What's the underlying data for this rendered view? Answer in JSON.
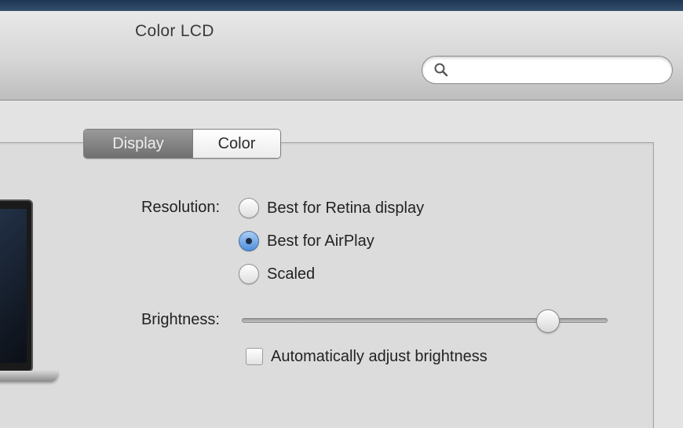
{
  "window": {
    "title": "Color LCD"
  },
  "search": {
    "placeholder": "",
    "value": "",
    "icon": "magnifier-icon"
  },
  "tabs": [
    {
      "label": "Display",
      "selected": true
    },
    {
      "label": "Color",
      "selected": false
    }
  ],
  "resolution": {
    "label": "Resolution:",
    "options": [
      {
        "label": "Best for Retina display",
        "selected": false
      },
      {
        "label": "Best for AirPlay",
        "selected": true
      },
      {
        "label": "Scaled",
        "selected": false
      }
    ]
  },
  "brightness": {
    "label": "Brightness:",
    "level": 0.86,
    "auto_adjust": {
      "label": "Automatically adjust brightness",
      "checked": false
    }
  },
  "colors": {
    "radio_selected": "#4f8fdc",
    "tab_selected": "#7a7a7a"
  }
}
